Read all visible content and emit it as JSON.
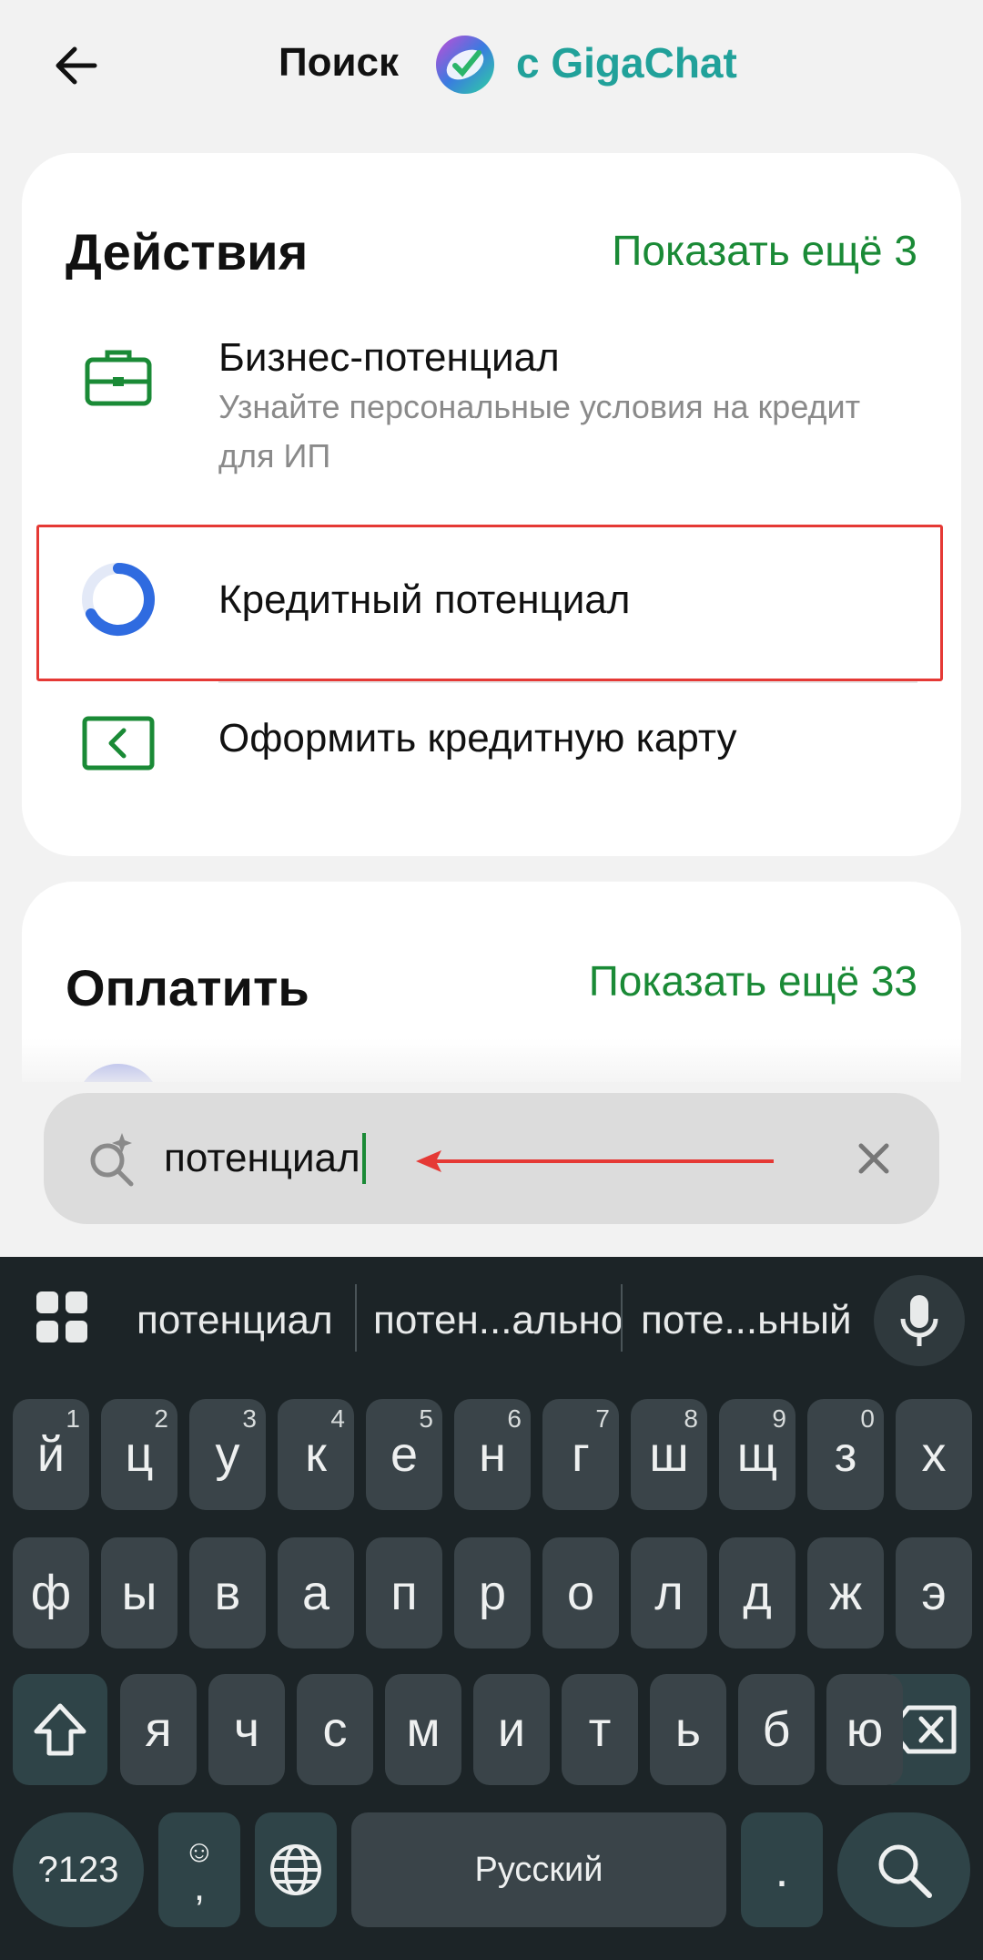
{
  "header": {
    "title": "Поиск",
    "brand": "с GigaChat",
    "icons": {
      "back": "arrow-left-icon",
      "logo": "gigachat-logo"
    }
  },
  "actions": {
    "title": "Действия",
    "show_more": "Показать ещё 3",
    "items": [
      {
        "title": "Бизнес-потенциал",
        "subtitle": "Узнайте персональные условия на кредит для ИП",
        "icon": "briefcase-icon"
      },
      {
        "title": "Кредитный потенциал",
        "icon": "credit-potential-ring-icon"
      },
      {
        "title": "Оформить кредитную карту",
        "icon": "credit-card-icon"
      }
    ]
  },
  "pay": {
    "title": "Оплатить",
    "show_more": "Показать ещё 33"
  },
  "search": {
    "value": "потенциал",
    "icons": {
      "search": "ai-search-icon",
      "clear": "close-icon"
    }
  },
  "keyboard": {
    "suggestions": [
      "потенциал",
      "потен...ально",
      "поте...ьный"
    ],
    "row1": [
      {
        "k": "й",
        "h": "1"
      },
      {
        "k": "ц",
        "h": "2"
      },
      {
        "k": "у",
        "h": "3"
      },
      {
        "k": "к",
        "h": "4"
      },
      {
        "k": "е",
        "h": "5"
      },
      {
        "k": "н",
        "h": "6"
      },
      {
        "k": "г",
        "h": "7"
      },
      {
        "k": "ш",
        "h": "8"
      },
      {
        "k": "щ",
        "h": "9"
      },
      {
        "k": "з",
        "h": "0"
      },
      {
        "k": "х",
        "h": ""
      }
    ],
    "row2": [
      "ф",
      "ы",
      "в",
      "а",
      "п",
      "р",
      "о",
      "л",
      "д",
      "ж",
      "э"
    ],
    "row3": [
      "я",
      "ч",
      "с",
      "м",
      "и",
      "т",
      "ь",
      "б",
      "ю"
    ],
    "sym_label": "?123",
    "emoji_glyph": "☺",
    "comma": ",",
    "space_label": "Русский",
    "dot": ".",
    "colors": {
      "background": "#1c2427",
      "key": "#3a4449",
      "accent": "#1a8a36"
    }
  },
  "colors": {
    "link": "#1a8a36",
    "highlight": "#e53935",
    "brand": "#21a19a"
  }
}
